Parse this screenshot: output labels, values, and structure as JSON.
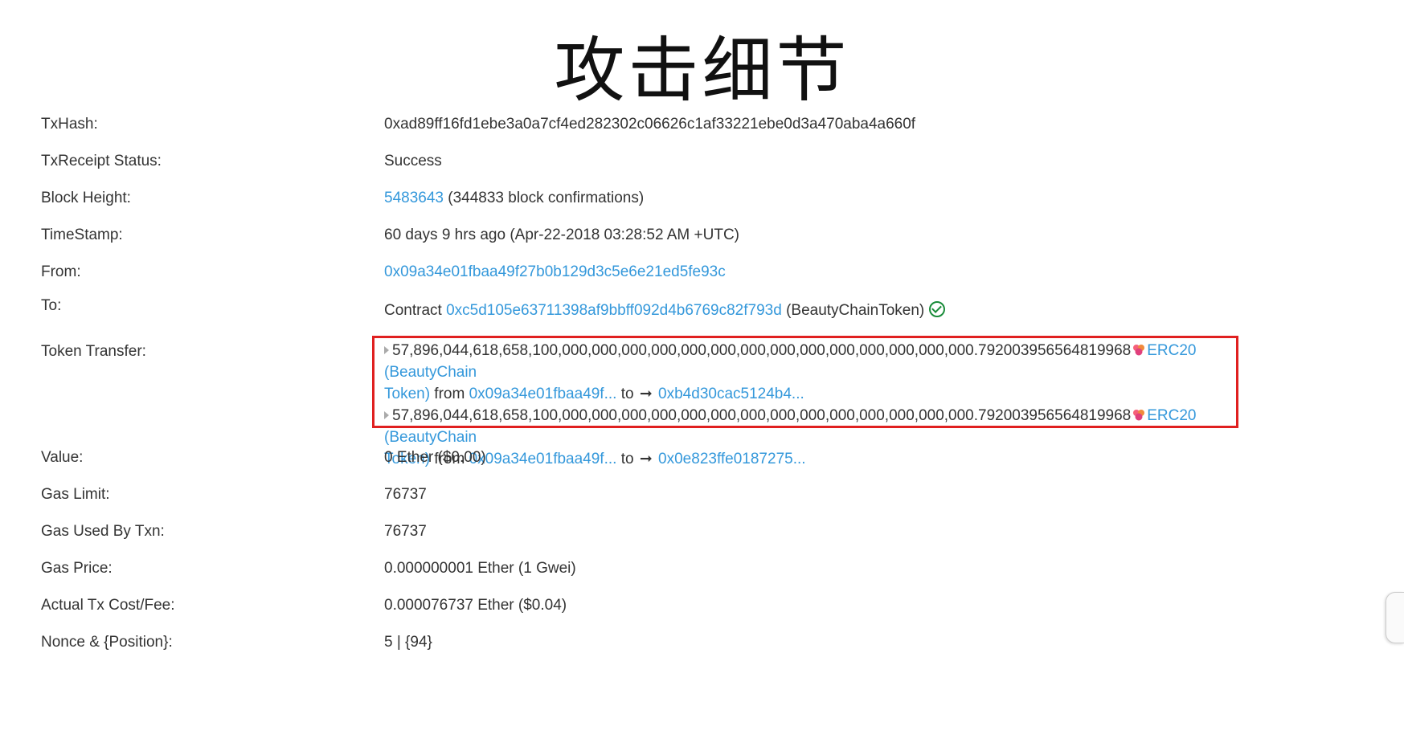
{
  "slide_title": "攻击细节",
  "rows": {
    "txhash": {
      "label": "TxHash:",
      "value": "0xad89ff16fd1ebe3a0a7cf4ed282302c06626c1af33221ebe0d3a470aba4a660f"
    },
    "status": {
      "label": "TxReceipt Status:",
      "value": "Success"
    },
    "block": {
      "label": "Block Height:",
      "link": "5483643",
      "suffix": " (344833 block confirmations)"
    },
    "timestamp": {
      "label": "TimeStamp:",
      "value": "60 days 9 hrs ago (Apr-22-2018 03:28:52 AM +UTC)"
    },
    "from": {
      "label": "From:",
      "link": "0x09a34e01fbaa49f27b0b129d3c5e6e21ed5fe93c"
    },
    "to": {
      "label": "To:",
      "prefix": "Contract ",
      "link": "0xc5d105e63711398af9bbff092d4b6769c82f793d",
      "suffix": " (BeautyChainToken)"
    },
    "token_transfer": {
      "label": "Token Transfer:",
      "transfers": [
        {
          "amount": "57,896,044,618,658,100,000,000,000,000,000,000,000,000,000,000,000,000,000,000.792003956564819968",
          "token_line1": "ERC20 (BeautyChain",
          "token_line2": "Token)",
          "from_label": " from ",
          "from_addr": "0x09a34e01fbaa49f...",
          "to_label": " to ",
          "to_addr": "0xb4d30cac5124b4..."
        },
        {
          "amount": "57,896,044,618,658,100,000,000,000,000,000,000,000,000,000,000,000,000,000,000.792003956564819968",
          "token_line1": "ERC20 (BeautyChain",
          "token_line2": "Token)",
          "from_label": " from ",
          "from_addr": "0x09a34e01fbaa49f...",
          "to_label": " to ",
          "to_addr": "0x0e823ffe0187275..."
        }
      ]
    },
    "value": {
      "label": "Value:",
      "value": "0 Ether ($0.00)"
    },
    "gas_limit": {
      "label": "Gas Limit:",
      "value": "76737"
    },
    "gas_used": {
      "label": "Gas Used By Txn:",
      "value": "76737"
    },
    "gas_price": {
      "label": "Gas Price:",
      "value": "0.000000001 Ether (1 Gwei)"
    },
    "tx_fee": {
      "label": "Actual Tx Cost/Fee:",
      "value": "0.000076737 Ether ($0.04)"
    },
    "nonce": {
      "label": "Nonce & {Position}:",
      "value": "5 | {94}"
    }
  },
  "colors": {
    "link": "#3498db",
    "success": "#2e8b2e",
    "highlight_border": "#e02020",
    "check": "#1a8c3a"
  },
  "icons": {
    "verified": "check-circle-icon",
    "token": "token-logo-icon",
    "expand": "triangle-right-icon",
    "arrow": "arrow-right-icon"
  }
}
